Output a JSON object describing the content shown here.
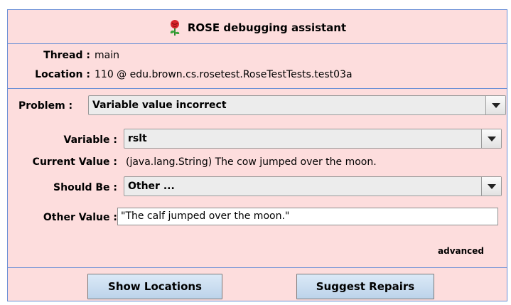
{
  "title": "ROSE debugging assistant",
  "icon": "rose-icon",
  "thread": {
    "label": "Thread :",
    "value": "main"
  },
  "location": {
    "label": "Location :",
    "value": "110 @ edu.brown.cs.rosetest.RoseTestTests.test03a"
  },
  "problem": {
    "label": "Problem :",
    "selected": "Variable value incorrect"
  },
  "variable": {
    "label": "Variable :",
    "selected": "rslt"
  },
  "current_value": {
    "label": "Current Value :",
    "value": "(java.lang.String) The cow jumped over the moon."
  },
  "should_be": {
    "label": "Should Be :",
    "selected": "Other ..."
  },
  "other_value": {
    "label": "Other Value :",
    "value": "\"The calf jumped over the moon.\""
  },
  "advanced_link": "advanced",
  "buttons": {
    "show_locations": "Show Locations",
    "suggest_repairs": "Suggest Repairs"
  },
  "colors": {
    "panel_bg": "#fddddd",
    "border": "#6a8fd6",
    "button_bg": "#c9dcef"
  }
}
